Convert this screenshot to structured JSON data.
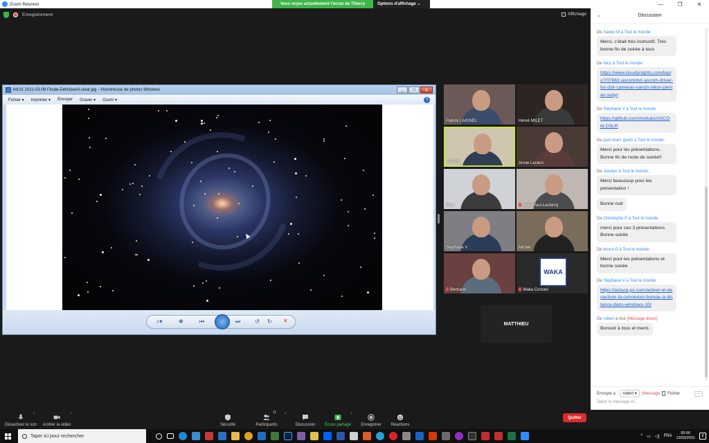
{
  "window": {
    "title": "Zoom Réunion"
  },
  "share_banner": {
    "message": "Vous voyez actuellement l'écran de Thierry",
    "options": "Options d'affichage"
  },
  "meeting": {
    "recording": "Enregistrement",
    "view": "Affichage"
  },
  "viewer": {
    "title": "M101 2021-03-09 Finale-DeNoiseAI-clear.jpg - Visionneuse de photos Windows",
    "menu": [
      "Fichier",
      "Imprimer",
      "Envoyer",
      "Graver",
      "Ouvrir"
    ]
  },
  "gallery": [
    {
      "name": "Patrick LAIGNEL",
      "muted": false,
      "active": false
    },
    {
      "name": "Hervé MILET",
      "muted": false,
      "active": false
    },
    {
      "name": "Thierry",
      "muted": false,
      "active": true
    },
    {
      "name": "Annie Leclerc",
      "muted": false,
      "active": false
    },
    {
      "name": "Nico",
      "muted": false,
      "active": false
    },
    {
      "name": "Jean-Paul Leclercq",
      "muted": true,
      "active": false
    },
    {
      "name": "Stephane V",
      "muted": false,
      "active": false
    },
    {
      "name": "Michel",
      "muted": false,
      "active": false
    },
    {
      "name": "Bertrand",
      "muted": true,
      "active": false
    },
    {
      "name": "Waka Conseil",
      "muted": true,
      "active": false
    }
  ],
  "waka_logo": "WAKA",
  "no_video_participant": "MATTHIEU",
  "chat": {
    "title": "Discussion",
    "messages": [
      {
        "de": "De",
        "from": "Xavier M",
        "to": "à Tout le monde:",
        "texts": [
          "Merci, c'était très instructif. Très bonne fin de soirée à tous"
        ],
        "link": false
      },
      {
        "de": "De",
        "from": "Nico",
        "to": "à Tout le monde:",
        "texts": [
          "https://www.cloudynights.com/topic/707662-ascomdslr-ascom-driver-for-dslr-cameras-canon-nikon-pentax-sony/"
        ],
        "link": true
      },
      {
        "de": "De",
        "from": "Stéphane V",
        "to": "à Tout le monde:",
        "texts": [
          "https://github.com/vtorkalo/ASCOM.DSLR"
        ],
        "link": true
      },
      {
        "de": "De",
        "from": "jean-marc goetz",
        "to": "à Tout le monde:",
        "texts": [
          "Merci pour les présentations. Bonne fin de reste de soirée!!"
        ],
        "link": false
      },
      {
        "de": "De",
        "from": "Jocelyn",
        "to": "à Tout le monde:",
        "texts": [
          "Merci beaucoup pour les présentation !",
          "Bonne nuit"
        ],
        "link": false
      },
      {
        "de": "De",
        "from": "Christophe P",
        "to": "à Tout le monde:",
        "texts": [
          "merci  pour ces 3 présentations.  Bonne soirée"
        ],
        "link": false
      },
      {
        "de": "De",
        "from": "bruno D",
        "to": "à Tout le monde:",
        "texts": [
          "Merci pour les présentations et bonne soirée"
        ],
        "link": false
      },
      {
        "de": "De",
        "from": "Stéphane V",
        "to": "à Tout le monde:",
        "texts": [
          "https://astuce-pc.com/activer-et-desactiver-la-connexion-bureau-a-distance-dans-windows-10/"
        ],
        "link": true
      },
      {
        "de": "De",
        "from": "robert",
        "to": "à moi",
        "direct": "(Message direct)",
        "texts": [
          "Bonsoir à tous et merci."
        ],
        "link": false
      }
    ],
    "compose": {
      "send_to": "Envoyer à :",
      "recipient": "robert",
      "direct": "(Message",
      "file": "Fichier",
      "more": "···",
      "placeholder": "Saisir le message ici..."
    }
  },
  "toolbar": {
    "mute": "Désactiver le son",
    "video": "Arrêter la vidéo",
    "security": "Sécurité",
    "participants": "Participants",
    "participants_count": "11",
    "chat": "Discussion",
    "share": "Écran partagé",
    "record": "Enregistrer",
    "reactions": "Réactions",
    "quit": "Quitter"
  },
  "taskbar": {
    "search_placeholder": "Taper ici pour rechercher",
    "lang": "FRA",
    "time": "00:00",
    "date": "13/03/2021",
    "notifications": "8"
  }
}
